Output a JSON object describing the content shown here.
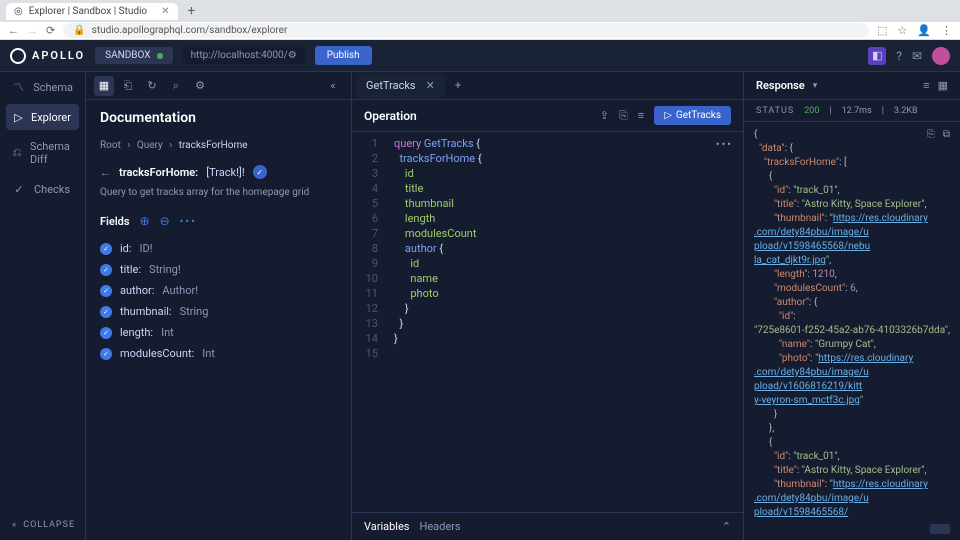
{
  "browser": {
    "tab_title": "Explorer | Sandbox | Studio",
    "url": "studio.apollographql.com/sandbox/explorer"
  },
  "header": {
    "logo": "APOLLO",
    "sandbox_label": "SANDBOX",
    "graph_url": "http://localhost:4000/",
    "publish": "Publish"
  },
  "sidebar": {
    "items": [
      {
        "label": "Schema",
        "icon": "schema"
      },
      {
        "label": "Explorer",
        "icon": "explorer"
      },
      {
        "label": "Schema Diff",
        "icon": "diff"
      },
      {
        "label": "Checks",
        "icon": "checks"
      }
    ],
    "collapse": "COLLAPSE"
  },
  "documentation": {
    "title": "Documentation",
    "breadcrumb": {
      "root": "Root",
      "query": "Query",
      "current": "tracksForHome"
    },
    "selected_field": {
      "name": "tracksForHome:",
      "type": "[Track!]!"
    },
    "description": "Query to get tracks array for the homepage grid",
    "fields_label": "Fields",
    "fields": [
      {
        "name": "id:",
        "type": "ID!"
      },
      {
        "name": "title:",
        "type": "String!"
      },
      {
        "name": "author:",
        "type": "Author!"
      },
      {
        "name": "thumbnail:",
        "type": "String"
      },
      {
        "name": "length:",
        "type": "Int"
      },
      {
        "name": "modulesCount:",
        "type": "Int"
      }
    ]
  },
  "editor": {
    "tab_name": "GetTracks",
    "section_title": "Operation",
    "run_label": "GetTracks",
    "code_lines": [
      "query GetTracks {",
      "  tracksForHome {",
      "    id",
      "    title",
      "    thumbnail",
      "    length",
      "    modulesCount",
      "    author {",
      "      id",
      "      name",
      "      photo",
      "    }",
      "  }",
      "}",
      ""
    ],
    "footer": {
      "variables": "Variables",
      "headers": "Headers"
    }
  },
  "response": {
    "title": "Response",
    "status_label": "STATUS",
    "status_code": "200",
    "latency": "12.7ms",
    "size": "3.2KB",
    "json": {
      "data": {
        "tracksForHome": [
          {
            "id": "track_01",
            "title": "Astro Kitty, Space Explorer",
            "thumbnail": "https://res.cloudinary.com/dety84pbu/image/upload/v1598465568/nebula_cat_djkt9r.jpg",
            "length": 1210,
            "modulesCount": 6,
            "author": {
              "id": "725e8601-f252-45a2-ab76-4103326b7dda",
              "name": "Grumpy Cat",
              "photo": "https://res.cloudinary.com/dety84pbu/image/upload/v1606816219/kitty-veyron-sm_mctf3c.jpg"
            }
          },
          {
            "id": "track_01",
            "title": "Astro Kitty, Space Explorer",
            "thumbnail": "https://res.cloudinary.com/dety84pbu/image/upload/v1598465568/"
          }
        ]
      }
    }
  }
}
